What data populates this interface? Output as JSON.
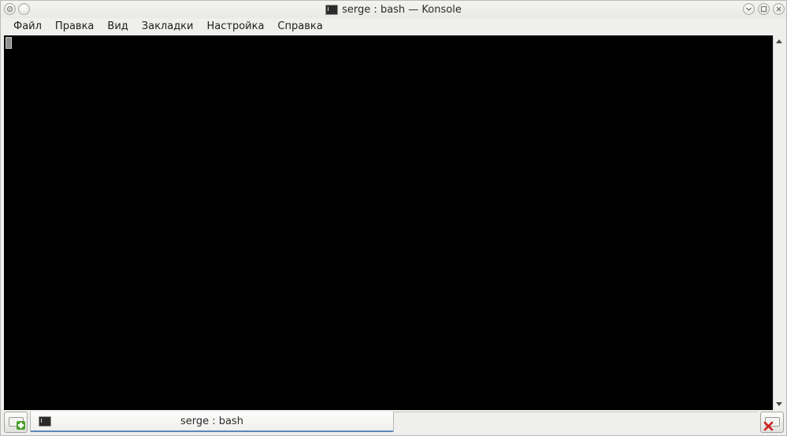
{
  "window": {
    "title": "serge : bash — Konsole",
    "app_icon": "terminal-icon"
  },
  "titlebar_buttons": {
    "left": [
      "menu-icon",
      "sticky-icon"
    ],
    "right": [
      "minimize-icon",
      "maximize-icon",
      "close-icon"
    ]
  },
  "menubar": {
    "items": [
      {
        "label": "Файл"
      },
      {
        "label": "Правка"
      },
      {
        "label": "Вид"
      },
      {
        "label": "Закладки"
      },
      {
        "label": "Настройка"
      },
      {
        "label": "Справка"
      }
    ]
  },
  "terminal": {
    "background": "#000000",
    "cursor_color": "#8f8f8f",
    "content": ""
  },
  "tabs": [
    {
      "label": "serge : bash",
      "icon": "terminal-icon",
      "active": true
    }
  ],
  "tabbar": {
    "new_tab_icon": "new-tab-icon",
    "close_tab_icon": "close-tab-icon",
    "active_underline_color": "#5b86b8"
  }
}
